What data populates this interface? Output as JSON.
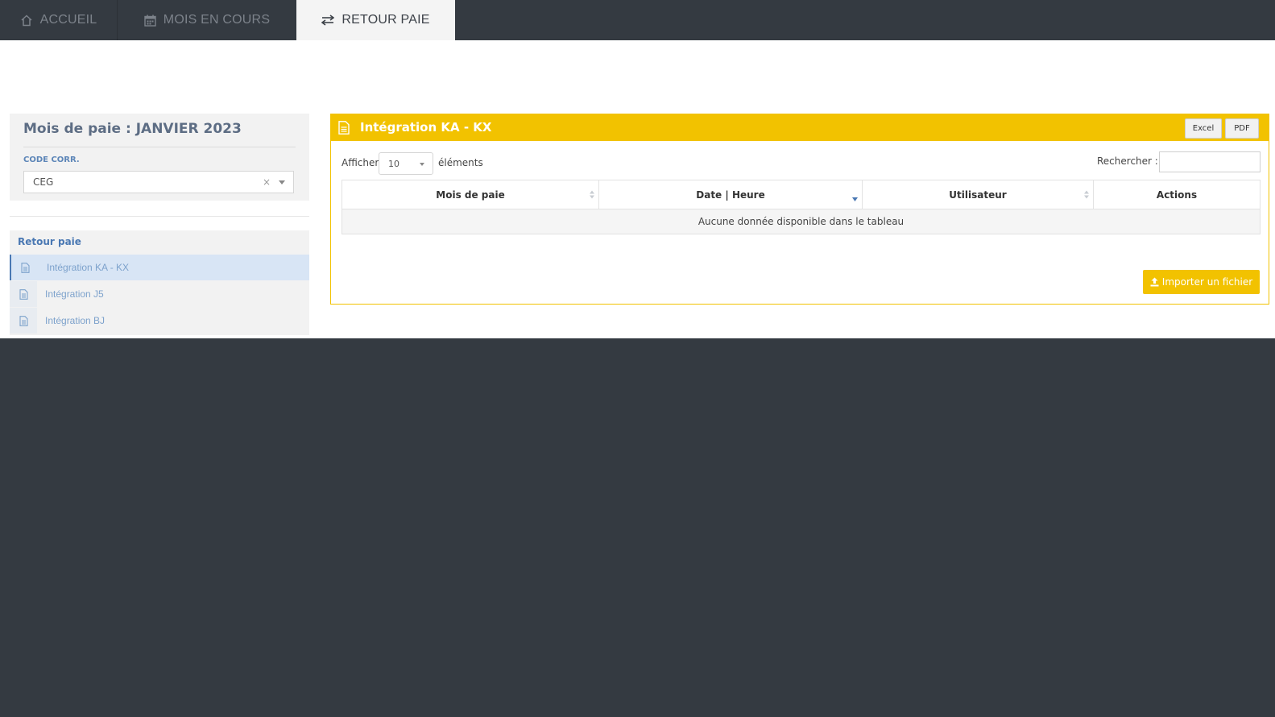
{
  "nav": {
    "tabs": [
      {
        "label": "ACCUEIL",
        "icon": "home-icon"
      },
      {
        "label": "MOIS EN COURS",
        "icon": "calendar-icon"
      },
      {
        "label": "RETOUR PAIE",
        "icon": "exchange-icon",
        "active": true
      }
    ]
  },
  "sidebar": {
    "title": "Mois de paie : JANVIER 2023",
    "code_label": "CODE CORR.",
    "code_value": "CEG",
    "clear_symbol": "×",
    "menu_title": "Retour paie",
    "items": [
      {
        "label": "Intégration KA - KX",
        "icon": "file-icon",
        "active": true
      },
      {
        "label": "Intégration J5",
        "icon": "file-icon"
      },
      {
        "label": "Intégration BJ",
        "icon": "file-icon"
      }
    ]
  },
  "panel": {
    "title": "Intégration KA - KX",
    "excel_label": "Excel",
    "pdf_label": "PDF",
    "show_label": "Afficher",
    "length_value": "10",
    "elements_label": "éléments",
    "search_label": "Rechercher :",
    "search_value": "",
    "columns": [
      "Mois de paie",
      "Date | Heure",
      "Utilisateur",
      "Actions"
    ],
    "empty_message": "Aucune donnée disponible dans le tableau",
    "import_label": "Importer un fichier"
  },
  "colors": {
    "topbar": "#343a41",
    "accent": "#f2c200",
    "link": "#4a78b3"
  }
}
